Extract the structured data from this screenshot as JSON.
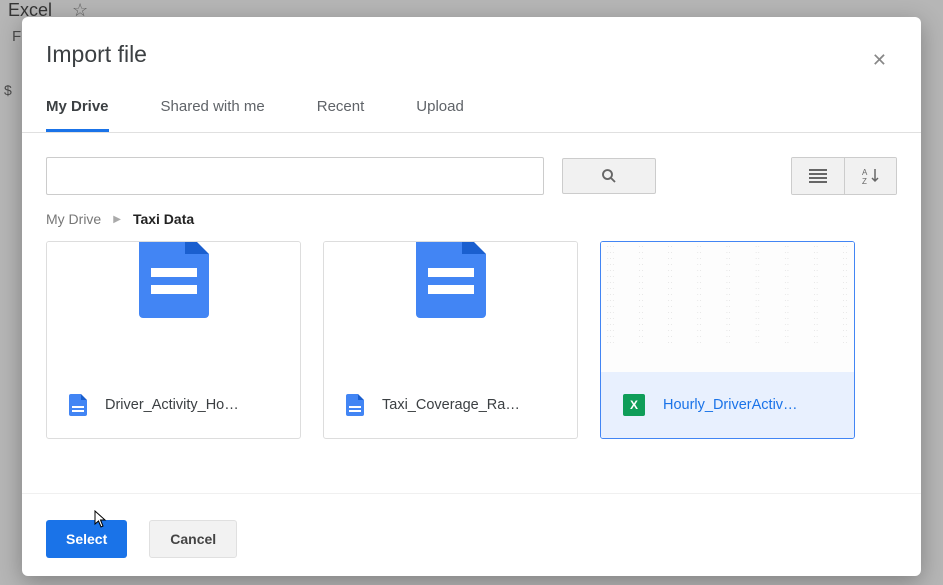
{
  "background": {
    "partial_title": "Excel",
    "left_fragment_1": "F",
    "left_fragment_2": "$"
  },
  "modal": {
    "title": "Import file",
    "close_glyph": "✕"
  },
  "tabs": [
    {
      "label": "My Drive",
      "active": true
    },
    {
      "label": "Shared with me",
      "active": false
    },
    {
      "label": "Recent",
      "active": false
    },
    {
      "label": "Upload",
      "active": false
    }
  ],
  "search": {
    "value": "",
    "placeholder": ""
  },
  "breadcrumb": [
    {
      "label": "My Drive",
      "current": false
    },
    {
      "label": "Taxi Data",
      "current": true
    }
  ],
  "files": [
    {
      "name": "Driver_Activity_Ho…",
      "type": "doc",
      "selected": false
    },
    {
      "name": "Taxi_Coverage_Ra…",
      "type": "doc",
      "selected": false
    },
    {
      "name": "Hourly_DriverActiv…",
      "type": "sheet",
      "selected": true
    }
  ],
  "icons": {
    "sheet_letter": "X",
    "breadcrumb_sep": "▶"
  },
  "actions": {
    "select": "Select",
    "cancel": "Cancel"
  }
}
